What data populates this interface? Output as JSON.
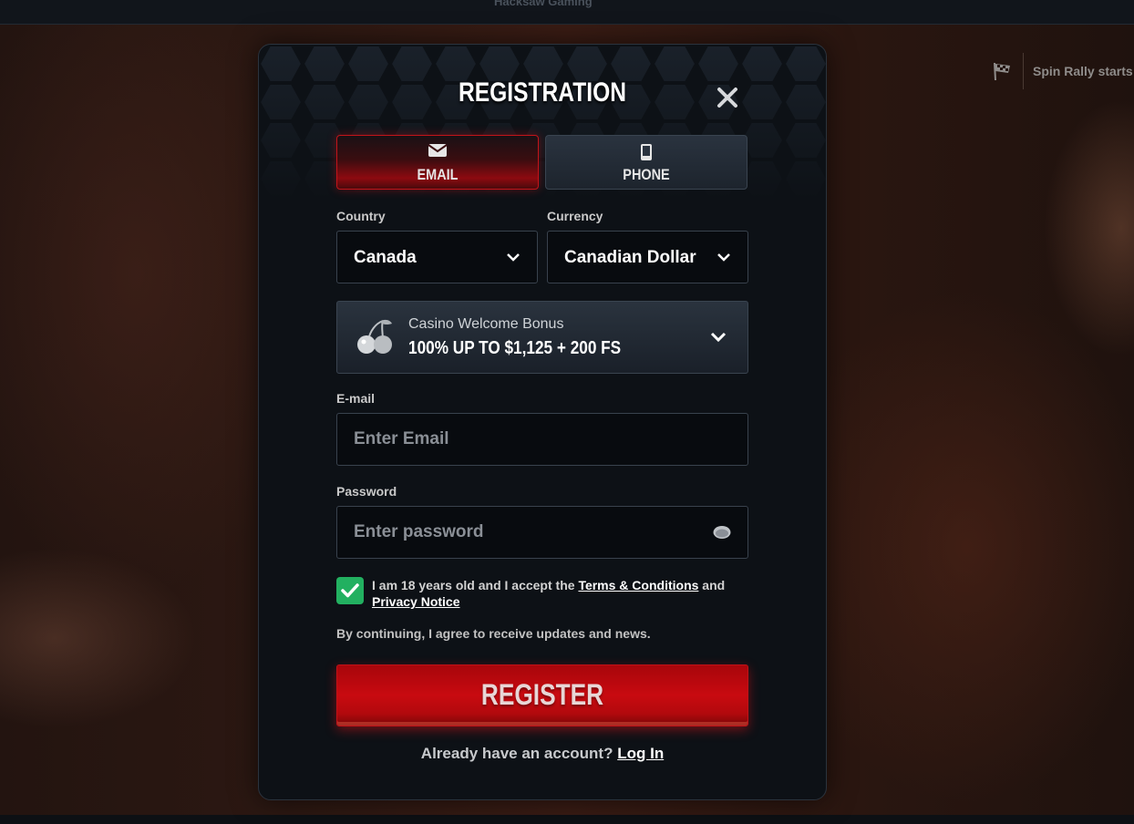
{
  "background": {
    "provider_text": "Hacksaw Gaming",
    "promo_text": "Spin Rally starts in"
  },
  "modal": {
    "title": "REGISTRATION",
    "tabs": [
      {
        "label": "EMAIL",
        "icon": "envelope-icon",
        "active": true
      },
      {
        "label": "PHONE",
        "icon": "phone-icon",
        "active": false
      }
    ],
    "country": {
      "label": "Country",
      "value": "Canada"
    },
    "currency": {
      "label": "Currency",
      "value": "Canadian Dollar"
    },
    "bonus": {
      "title": "Casino Welcome Bonus",
      "offer": "100% UP TO $1,125 + 200 FS",
      "icon": "cherry-icon"
    },
    "email": {
      "label": "E-mail",
      "placeholder": "Enter Email"
    },
    "password": {
      "label": "Password",
      "placeholder": "Enter password"
    },
    "terms": {
      "checked": true,
      "prefix": "I am 18 years old and I accept the",
      "terms_link": "Terms & Conditions",
      "and": "and",
      "privacy_link": "Privacy Notice"
    },
    "agree_text": "By continuing, I agree to receive updates and news.",
    "register_label": "REGISTER",
    "account_prompt": "Already have an account?",
    "login_link": "Log In"
  },
  "colors": {
    "accent_red": "#c80a10",
    "check_green": "#22b060",
    "modal_bg": "#0d1116"
  }
}
